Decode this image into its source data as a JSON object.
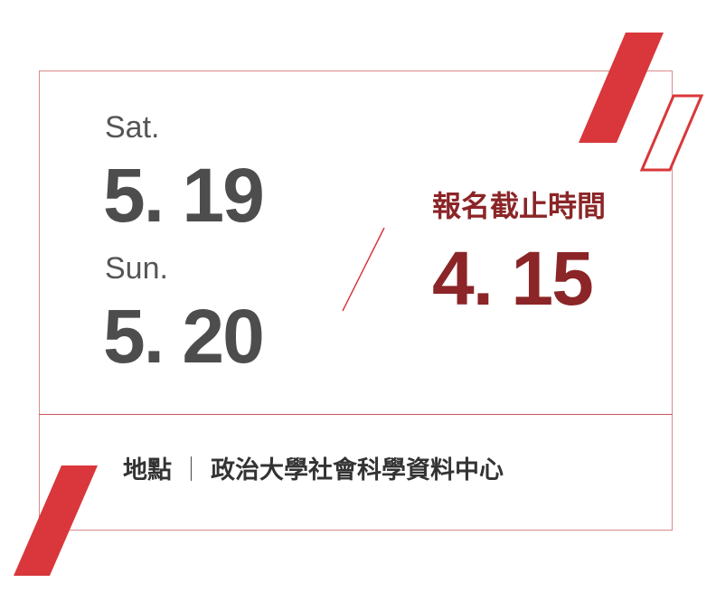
{
  "schedule": {
    "day1": {
      "weekday": "Sat.",
      "date": "5. 19"
    },
    "day2": {
      "weekday": "Sun.",
      "date": "5. 20"
    }
  },
  "deadline": {
    "label": "報名截止時間",
    "date": "4. 15"
  },
  "location": {
    "label": "地點",
    "separator": "｜",
    "place": "政治大學社會科學資料中心"
  },
  "colors": {
    "accent_red": "#d9373b",
    "deadline_text": "#8b2527",
    "frame": "#d98a8c",
    "date_text": "#4d4d4d"
  }
}
